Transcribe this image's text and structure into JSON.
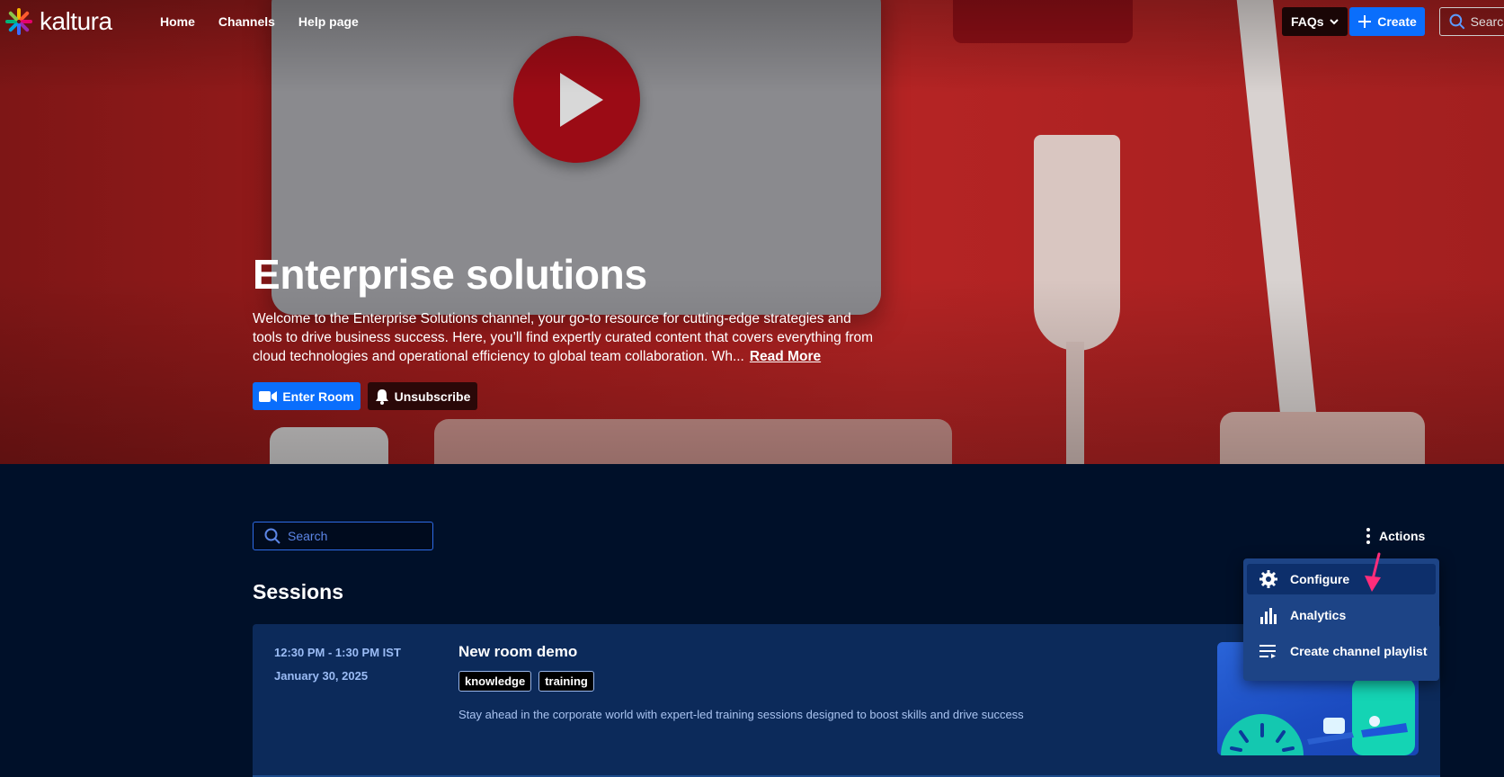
{
  "app": {
    "logo_text": "kaltura"
  },
  "nav": {
    "links": [
      "Home",
      "Channels",
      "Help page"
    ]
  },
  "header_actions": {
    "faqs_label": "FAQs",
    "create_label": "Create",
    "search_placeholder": "Search"
  },
  "hero": {
    "title": "Enterprise solutions",
    "description": "Welcome to the Enterprise Solutions channel, your go-to resource for cutting-edge strategies and tools to drive business success. Here, you’ll find expertly curated content that covers everything from cloud technologies and operational efficiency to global team collaboration. Wh...",
    "read_more": "Read More",
    "enter_room_label": "Enter Room",
    "unsubscribe_label": "Unsubscribe"
  },
  "channel": {
    "search_placeholder": "Search",
    "actions_label": "Actions",
    "sessions_title": "Sessions"
  },
  "actions_menu": {
    "items": [
      {
        "label": "Configure",
        "icon": "gear-icon"
      },
      {
        "label": "Analytics",
        "icon": "bar-chart-icon"
      },
      {
        "label": "Create channel playlist",
        "icon": "playlist-icon"
      }
    ]
  },
  "session": {
    "time": "12:30 PM - 1:30 PM IST",
    "date": "January 30, 2025",
    "title": "New room demo",
    "tags": [
      "knowledge",
      "training"
    ],
    "description": "Stay ahead in the corporate world with expert-led training sessions designed to boost skills and drive success"
  },
  "colors": {
    "accent": "#0a6efc",
    "page_bg": "#001029",
    "card_bg": "#0c2a5a",
    "menu_bg": "#1d4486",
    "annotation_arrow": "#ff2d7a"
  }
}
